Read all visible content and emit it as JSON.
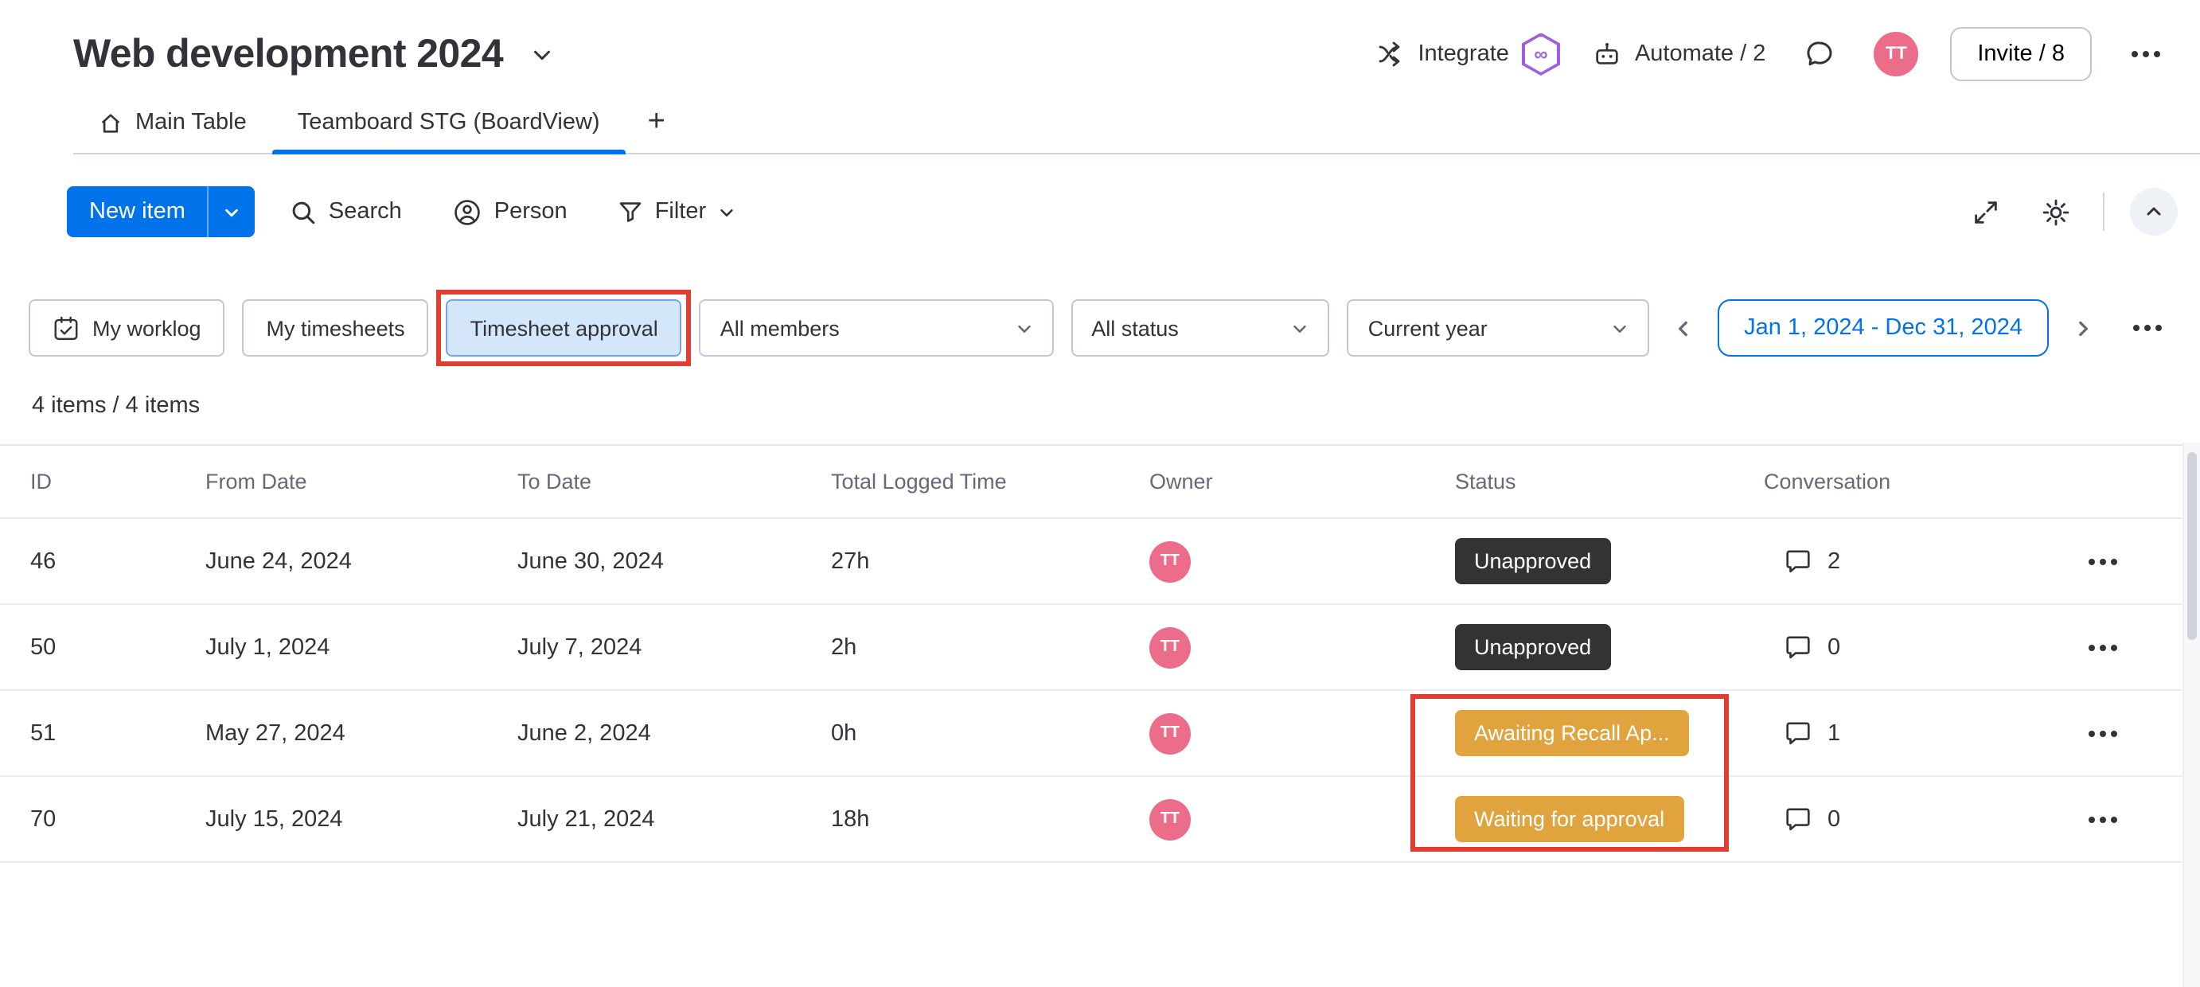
{
  "board": {
    "title": "Web development 2024",
    "items_count": "4 items / 4 items"
  },
  "header": {
    "integrate_label": "Integrate",
    "automate_label": "Automate / 2",
    "invite_label": "Invite / 8",
    "avatar_initials": "TT"
  },
  "tabs": {
    "main_table": "Main Table",
    "board_view": "Teamboard STG (BoardView)",
    "add_tab": "+"
  },
  "toolbar": {
    "new_item": "New item",
    "search": "Search",
    "person": "Person",
    "filter": "Filter"
  },
  "filterbar": {
    "my_worklog": "My worklog",
    "my_timesheets": "My timesheets",
    "timesheet_approval": "Timesheet approval",
    "all_members": "All members",
    "all_status": "All status",
    "current_year": "Current year",
    "date_range": "Jan 1, 2024 - Dec 31, 2024"
  },
  "table": {
    "columns": [
      "ID",
      "From Date",
      "To Date",
      "Total Logged Time",
      "Owner",
      "Status",
      "Conversation"
    ],
    "rows": [
      {
        "id": "46",
        "from_date": "June 24, 2024",
        "to_date": "June 30, 2024",
        "total_logged": "27h",
        "owner": "TT",
        "status": "Unapproved",
        "status_type": "dark",
        "conversation": "2"
      },
      {
        "id": "50",
        "from_date": "July 1, 2024",
        "to_date": "July 7, 2024",
        "total_logged": "2h",
        "owner": "TT",
        "status": "Unapproved",
        "status_type": "dark",
        "conversation": "0"
      },
      {
        "id": "51",
        "from_date": "May 27, 2024",
        "to_date": "June 2, 2024",
        "total_logged": "0h",
        "owner": "TT",
        "status": "Awaiting Recall Ap...",
        "status_type": "gold",
        "conversation": "1"
      },
      {
        "id": "70",
        "from_date": "July 15, 2024",
        "to_date": "July 21, 2024",
        "total_logged": "18h",
        "owner": "TT",
        "status": "Waiting for approval",
        "status_type": "gold",
        "conversation": "0"
      }
    ]
  },
  "icons": {
    "infinity": "∞"
  },
  "colors": {
    "primary_blue": "#0073ea",
    "avatar_pink": "#ec6d8a",
    "badge_dark": "#333333",
    "badge_gold": "#e0a33e",
    "highlight_red": "#e03e32",
    "text_primary": "#323338",
    "text_secondary": "#676879"
  }
}
